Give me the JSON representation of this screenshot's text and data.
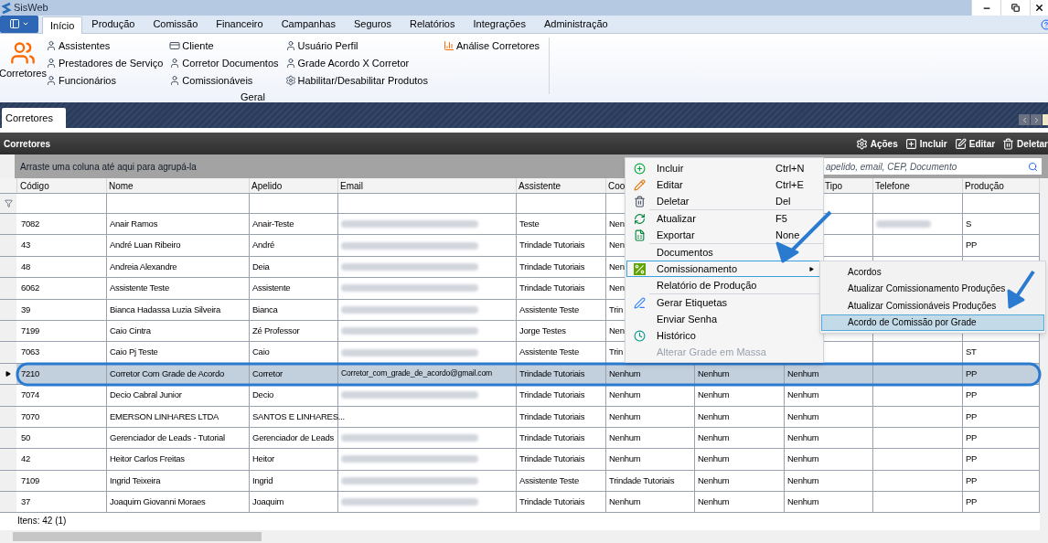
{
  "window": {
    "title": "SisWeb"
  },
  "ribbon_tabs": [
    {
      "label": "Início",
      "selected": true
    },
    {
      "label": "Produção",
      "selected": false
    },
    {
      "label": "Comissão",
      "selected": false
    },
    {
      "label": "Financeiro",
      "selected": false
    },
    {
      "label": "Campanhas",
      "selected": false
    },
    {
      "label": "Seguros",
      "selected": false
    },
    {
      "label": "Relatórios",
      "selected": false
    },
    {
      "label": "Integrações",
      "selected": false
    },
    {
      "label": "Administração",
      "selected": false
    }
  ],
  "ribbon": {
    "large_button": "Corretores",
    "columns": [
      [
        "Assistentes",
        "Prestadores de Serviço",
        "Funcionários"
      ],
      [
        "Cliente",
        "Corretor Documentos",
        "Comissionáveis"
      ],
      [
        "Usuário Perfil",
        "Grade Acordo X Corretor",
        "Habilitar/Desabilitar Produtos"
      ],
      [
        "Análise Corretores"
      ]
    ],
    "group_label": "Geral"
  },
  "document_tabs": [
    {
      "label": "Corretores",
      "selected": true
    }
  ],
  "panel": {
    "title": "Corretores",
    "toolbar": [
      "Ações",
      "Incluir",
      "Editar",
      "Deletar"
    ]
  },
  "group_panel": "Arraste uma coluna até aqui para agrupá-la",
  "search": {
    "placeholder": "apelido, email, CEP, Documento"
  },
  "table": {
    "columns": [
      {
        "label": "Código"
      },
      {
        "label": "Nome"
      },
      {
        "label": "Apelido"
      },
      {
        "label": "Email"
      },
      {
        "label": "Assistente"
      },
      {
        "label": "Coo"
      },
      {},
      {
        "label": "Tipo"
      },
      {
        "label": "Telefone"
      },
      {
        "label": "Produção"
      }
    ],
    "rows": [
      {
        "selected": false,
        "codigo": "7082",
        "nome": "Anair Ramos",
        "apelido": "Anair-Teste",
        "email_blurred": true,
        "assistente": "Teste",
        "column_6": "Nen",
        "telefone_blurred": true,
        "producao": "S"
      },
      {
        "selected": false,
        "codigo": "43",
        "nome": "André Luan Ribeiro",
        "apelido": "André",
        "email_blurred": true,
        "assistente": "Trindade Tutoriais",
        "column_6": "Nen",
        "producao": "PP"
      },
      {
        "selected": false,
        "codigo": "48",
        "nome": "Andreia Alexandre",
        "apelido": "Deia",
        "email_blurred": true,
        "assistente": "Trindade Tutoriais",
        "column_6": "Nen"
      },
      {
        "selected": false,
        "codigo": "6062",
        "nome": "Assistente Teste",
        "apelido": "Assistente",
        "email_blurred": true,
        "assistente": "Trindade Tutoriais",
        "column_6": "Nen"
      },
      {
        "selected": false,
        "codigo": "39",
        "nome": "Bianca Hadassa Luzia Silveira",
        "apelido": "Bianca",
        "email_blurred": true,
        "assistente": "Assistente Teste",
        "column_6": "Trin"
      },
      {
        "selected": false,
        "codigo": "7199",
        "nome": "Caio Cintra",
        "apelido": "Zé Professor",
        "email_blurred": true,
        "assistente": "Jorge Testes",
        "column_6": "Nen"
      },
      {
        "selected": false,
        "codigo": "7063",
        "nome": "Caio Pj Teste",
        "apelido": "Caio",
        "email_blurred": true,
        "assistente": "Assistente Teste",
        "column_6": "Trin",
        "producao": "ST"
      },
      {
        "selected": true,
        "codigo": "7210",
        "nome": "Corretor Com Grade de Acordo",
        "apelido": "Corretor",
        "email": "Corretor_com_grade_de_acordo@gmail.com",
        "assistente": "Trindade Tutoriais",
        "column_6": "Nenhum",
        "column_7": "Nenhum",
        "tipo": "Nenhum",
        "producao": "PP"
      },
      {
        "selected": false,
        "codigo": "7074",
        "nome": "Decio Cabral Junior",
        "apelido": "Decio",
        "email_blurred": true,
        "assistente": "Trindade Tutoriais",
        "column_6": "Nenhum",
        "column_7": "Nenhum",
        "tipo": "Nenhum",
        "producao": "PP"
      },
      {
        "selected": false,
        "codigo": "7070",
        "nome": "EMERSON LINHARES LTDA",
        "apelido": "SANTOS E LINHARES...",
        "assistente": "Trindade Tutoriais",
        "column_6": "Nenhum",
        "column_7": "Nenhum",
        "tipo": "Nenhum",
        "producao": "PP"
      },
      {
        "selected": false,
        "codigo": "50",
        "nome": "Gerenciador de Leads - Tutorial",
        "apelido": "Gerenciador de Leads",
        "email_blurred": true,
        "assistente": "Trindade Tutoriais",
        "column_6": "Nenhum",
        "column_7": "Nenhum",
        "tipo": "Nenhum",
        "producao": "PP"
      },
      {
        "selected": false,
        "codigo": "42",
        "nome": "Heitor Carlos Freitas",
        "apelido": "Heitor",
        "email_blurred": true,
        "assistente": "Trindade Tutoriais",
        "column_6": "Nenhum",
        "column_7": "Nenhum",
        "tipo": "Nenhum",
        "producao": "PP"
      },
      {
        "selected": false,
        "codigo": "7109",
        "nome": "Ingrid Teixeira",
        "apelido": "Ingrid",
        "email_blurred": true,
        "assistente": "Assistente Teste",
        "column_6": "Trindade Tutoriais",
        "column_7": "Nenhum",
        "tipo": "Nenhum",
        "producao": "PP"
      },
      {
        "selected": false,
        "codigo": "37",
        "nome": "Joaquim Giovanni Moraes",
        "apelido": "Joaquim",
        "email_blurred": true,
        "assistente": "Trindade Tutoriais",
        "column_6": "Nenhum",
        "column_7": "Nenhum",
        "tipo": "Nenhum",
        "producao": "PP"
      }
    ]
  },
  "status": "Itens: 42 (1)",
  "context_menu": {
    "items": [
      {
        "kind": "item",
        "label": "Incluir",
        "shortcut": "Ctrl+N",
        "selected": false,
        "disabled": false
      },
      {
        "kind": "item",
        "label": "Editar",
        "shortcut": "Ctrl+E",
        "selected": false,
        "disabled": false
      },
      {
        "kind": "item",
        "label": "Deletar",
        "shortcut": "Del",
        "selected": false,
        "disabled": false
      },
      {
        "kind": "separator"
      },
      {
        "kind": "item",
        "label": "Atualizar",
        "shortcut": "F5",
        "selected": false,
        "disabled": false
      },
      {
        "kind": "item",
        "label": "Exportar",
        "shortcut": "None",
        "selected": false,
        "disabled": false
      },
      {
        "kind": "separator"
      },
      {
        "kind": "item",
        "label": "Documentos",
        "selected": false,
        "disabled": false
      },
      {
        "kind": "submenu",
        "label": "Comissionamento",
        "selected": true,
        "disabled": false
      },
      {
        "kind": "item",
        "label": "Relatório de Produção",
        "selected": false,
        "disabled": false
      },
      {
        "kind": "separator"
      },
      {
        "kind": "item",
        "label": "Gerar Etiquetas",
        "selected": false,
        "disabled": false
      },
      {
        "kind": "item",
        "label": "Enviar Senha",
        "selected": false,
        "disabled": false
      },
      {
        "kind": "item",
        "label": "Histórico",
        "selected": false,
        "disabled": false
      },
      {
        "kind": "item",
        "label": "Alterar Grade em Massa",
        "selected": false,
        "disabled": true
      }
    ],
    "submenu": [
      {
        "label": "Acordos",
        "selected": false
      },
      {
        "label": "Atualizar Comissionamento Produções",
        "selected": false
      },
      {
        "label": "Atualizar Comissionáveis Produções",
        "selected": false
      },
      {
        "label": "Acordo de Comissão por Grade",
        "selected": true
      }
    ]
  }
}
